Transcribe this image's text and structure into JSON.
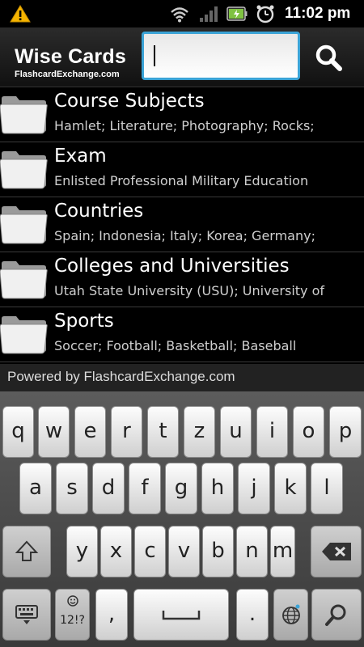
{
  "status_bar": {
    "time": "11:02 pm",
    "icons": [
      "warning-icon",
      "wifi-icon",
      "signal-icon",
      "battery-icon",
      "alarm-icon"
    ]
  },
  "header": {
    "app_title": "Wise Cards",
    "app_subtitle": "FlashcardExchange.com",
    "search": {
      "value": "",
      "placeholder": ""
    },
    "search_icon": "search-icon"
  },
  "list": {
    "items": [
      {
        "title": "Course Subjects",
        "subtitle": "Hamlet; Literature; Photography; Rocks;"
      },
      {
        "title": "Exam",
        "subtitle": "Enlisted Professional Military Education"
      },
      {
        "title": "Countries",
        "subtitle": "Spain; Indonesia; Italy; Korea; Germany;"
      },
      {
        "title": "Colleges and Universities",
        "subtitle": "Utah State University (USU); University of"
      },
      {
        "title": "Sports",
        "subtitle": "Soccer; Football; Basketball; Baseball"
      }
    ]
  },
  "footer": {
    "text": "Powered by FlashcardExchange.com"
  },
  "keyboard": {
    "row1": [
      "q",
      "w",
      "e",
      "r",
      "t",
      "z",
      "u",
      "i",
      "o",
      "p"
    ],
    "row2": [
      "a",
      "s",
      "d",
      "f",
      "g",
      "h",
      "j",
      "k",
      "l"
    ],
    "row3": [
      "y",
      "x",
      "c",
      "v",
      "b",
      "n",
      "m"
    ],
    "row4": {
      "symbols_label": "12!?",
      "comma": ",",
      "period": "."
    },
    "accent_color": "#3ba3d6"
  }
}
